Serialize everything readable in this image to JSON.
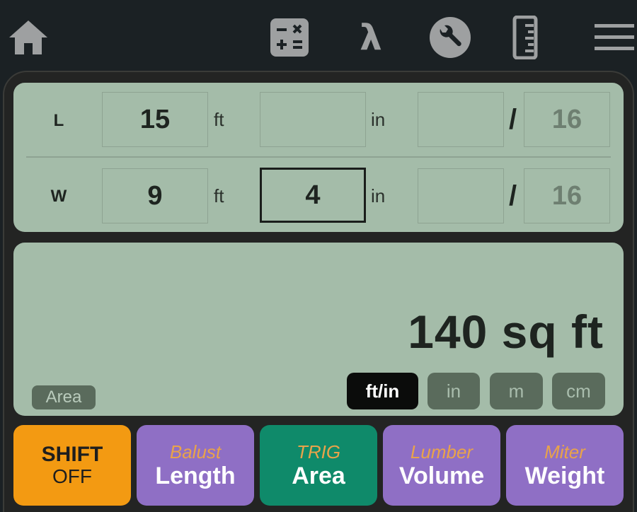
{
  "nav": {
    "icons": [
      "home-icon",
      "calculator-icon",
      "lambda-icon",
      "wrench-icon",
      "ruler-icon",
      "menu-icon"
    ],
    "lambda_glyph": "λ"
  },
  "inputs": {
    "length": {
      "label": "L",
      "feet": "15",
      "feet_unit": "ft",
      "inches": "",
      "inches_unit": "in",
      "numerator": "",
      "slash": "/",
      "denominator": "16"
    },
    "width": {
      "label": "W",
      "feet": "9",
      "feet_unit": "ft",
      "inches": "4",
      "inches_unit": "in",
      "numerator": "",
      "slash": "/",
      "denominator": "16"
    }
  },
  "result": {
    "value": "140 sq ft",
    "mode": "Area",
    "units": [
      {
        "label": "ft/in",
        "active": true
      },
      {
        "label": "in",
        "active": false
      },
      {
        "label": "m",
        "active": false
      },
      {
        "label": "cm",
        "active": false
      }
    ]
  },
  "keys": [
    {
      "top": "SHIFT",
      "bottom": "OFF",
      "color": "#f39a12"
    },
    {
      "top": "Balust",
      "bottom": "Length",
      "color": "#8f6fc5"
    },
    {
      "top": "TRIG",
      "bottom": "Area",
      "color": "#0f8a6a"
    },
    {
      "top": "Lumber",
      "bottom": "Volume",
      "color": "#8f6fc5"
    },
    {
      "top": "Miter",
      "bottom": "Weight",
      "color": "#8f6fc5"
    }
  ],
  "colors": {
    "background": "#1b2124",
    "display": "#a4bca9",
    "shift": "#f39a12",
    "function_key": "#8f6fc5",
    "trig_key": "#0f8a6a",
    "secondary_label": "#e9a34a"
  }
}
